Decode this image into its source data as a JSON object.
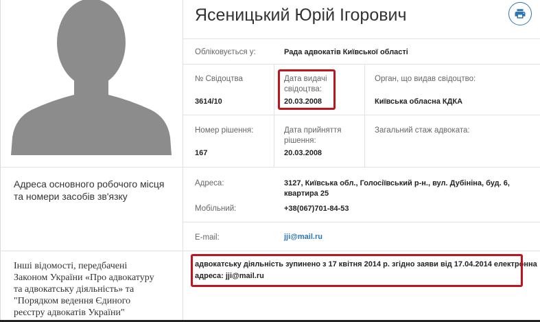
{
  "header": {
    "name": "Ясеницький Юрій Ігорович"
  },
  "fields": {
    "registered_label": "Обліковується у:",
    "registered_value": "Рада адвокатів Київської області",
    "cert_no_label": "№ Свідоцтва",
    "cert_no_value": "3614/10",
    "cert_date_label_1": "Дата видачі",
    "cert_date_label_2": "свідоцтва:",
    "cert_date_value": "20.03.2008",
    "issuer_label": "Орган, що видав свідоцтво:",
    "issuer_value": "Київська обласна КДКА",
    "decision_no_label": "Номер рішення:",
    "decision_no_value": "167",
    "decision_date_label_1": "Дата прийняття",
    "decision_date_label_2": "рішення:",
    "decision_date_value": "20.03.2008",
    "experience_label": "Загальний стаж адвоката:"
  },
  "contacts": {
    "section_title_1": "Адреса основного робочого місця",
    "section_title_2": "та номери засобів зв'язку",
    "address_label": "Адреса:",
    "address_line_1": "3127, Київська обл., Голосіївський р-н., вул. Дубініна, буд. 6,",
    "address_line_2": "квартира 25",
    "mobile_label": "Мобільний:",
    "mobile_value": "+38(067)701-84-53",
    "email_label": "E-mail:",
    "email_value": "jji@mail.ru"
  },
  "other": {
    "title_1": "Інші відомості, передбачені",
    "title_2": "Законом України «Про адвокатуру",
    "title_3": "та адвокатську діяльність» та",
    "title_4": "\"Порядком ведення Єдиного",
    "title_5": "реєстру адвокатів України\"",
    "text_1": "адвокатську діяльність зупинено з 17 квітня 2014 р. згідно заяви від 17.04.2014 електронна",
    "text_2": "адреса: jji@mail.ru"
  },
  "colors": {
    "accent": "#2a74b8",
    "highlight": "#c0141d"
  }
}
